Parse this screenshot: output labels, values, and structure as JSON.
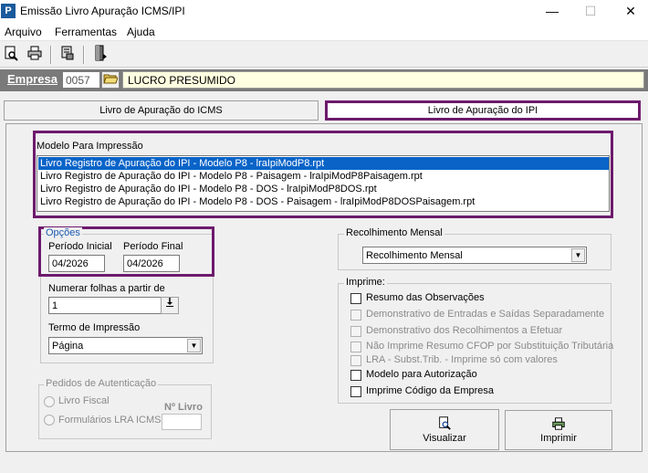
{
  "window": {
    "title": "Emissão Livro Apuração ICMS/IPI",
    "app_icon": "P",
    "minimize": "—",
    "maximize": "☐",
    "close": "✕"
  },
  "menu": [
    "Arquivo",
    "Ferramentas",
    "Ajuda"
  ],
  "toolbar": {
    "icons": [
      "print-preview-icon",
      "printer-icon",
      "form-icon",
      "exit-door-icon"
    ]
  },
  "empresa": {
    "label": "Empresa",
    "code": "0057",
    "name": "LUCRO PRESUMIDO"
  },
  "tabs": [
    {
      "label": "Livro de Apuração do ICMS",
      "active": false
    },
    {
      "label": "Livro de Apuração do IPI",
      "active": true
    }
  ],
  "modelo": {
    "label": "Modelo Para Impressão",
    "items": [
      "Livro Registro de Apuração do IPI - Modelo P8 - lraIpiModP8.rpt",
      "Livro Registro de Apuração do IPI - Modelo P8 - Paisagem - lraIpiModP8Paisagem.rpt",
      "Livro Registro de Apuração do IPI - Modelo P8 - DOS - lraIpiModP8DOS.rpt",
      "Livro Registro de Apuração do IPI - Modelo P8 - DOS - Paisagem - lraIpiModP8DOSPaisagem.rpt"
    ],
    "selected_index": 0
  },
  "opcoes": {
    "legend": "Opções",
    "periodo_inicial_label": "Período Inicial",
    "periodo_inicial": "04/2026",
    "periodo_final_label": "Período Final",
    "periodo_final": "04/2026",
    "numerar_label": "Numerar folhas a partir de",
    "numerar_value": "1",
    "termo_label": "Termo de Impressão",
    "termo_value": "Página"
  },
  "pedidos": {
    "legend": "Pedidos de Autenticação",
    "livro_fiscal": "Livro Fiscal",
    "formularios": "Formulários LRA ICMS",
    "n_livro_label": "Nº Livro",
    "n_livro_value": ""
  },
  "recolhimento": {
    "legend": "Recolhimento Mensal",
    "value": "Recolhimento Mensal"
  },
  "imprime": {
    "legend": "Imprime:",
    "options": [
      {
        "label": "Resumo das Observações",
        "enabled": true,
        "checked": false
      },
      {
        "label": "Demonstrativo de Entradas e Saídas Separadamente",
        "enabled": false,
        "checked": false
      },
      {
        "label": "Demonstrativo dos Recolhimentos a Efetuar",
        "enabled": false,
        "checked": false
      },
      {
        "label": "Não Imprime Resumo CFOP por Substituição Tributária",
        "enabled": false,
        "checked": false
      },
      {
        "label": "LRA - Subst.Trib. - Imprime só com valores",
        "enabled": false,
        "checked": false
      },
      {
        "label": "Modelo para Autorização",
        "enabled": true,
        "checked": false
      },
      {
        "label": "Imprime Código da Empresa",
        "enabled": true,
        "checked": false
      }
    ]
  },
  "buttons": {
    "visualizar": "Visualizar",
    "imprimir": "Imprimir"
  }
}
